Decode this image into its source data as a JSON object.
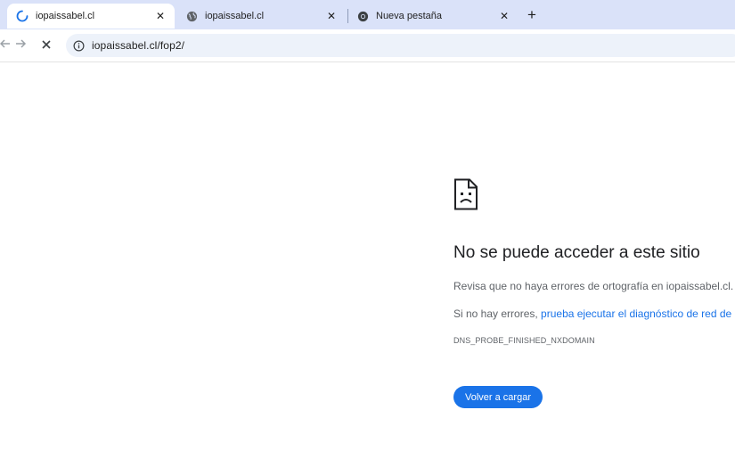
{
  "tabs": [
    {
      "title": "iopaissabel.cl",
      "icon": "loading-spinner-icon",
      "active": true
    },
    {
      "title": "iopaissabel.cl",
      "icon": "globe-icon",
      "active": false
    },
    {
      "title": "Nueva pestaña",
      "icon": "chrome-icon",
      "active": false
    }
  ],
  "new_tab_label": "+",
  "toolbar": {
    "back_icon": "arrow-left-icon",
    "forward_icon": "arrow-right-icon",
    "stop_icon": "stop-icon",
    "site_info_icon": "info-icon",
    "url": "iopaissabel.cl/fop2/"
  },
  "error": {
    "icon": "sad-page-icon",
    "title": "No se puede acceder a este sitio",
    "line1": "Revisa que no haya errores de ortografía en iopaissabel.cl.",
    "line2_prefix": "Si no hay errores, ",
    "line2_link": "prueba ejecutar el diagnóstico de red de",
    "code": "DNS_PROBE_FINISHED_NXDOMAIN",
    "reload_label": "Volver a cargar"
  },
  "colors": {
    "tabstrip_bg": "#dae2f9",
    "omnibox_bg": "#edf2fa",
    "link": "#1a73e8",
    "button": "#1a73e8"
  }
}
